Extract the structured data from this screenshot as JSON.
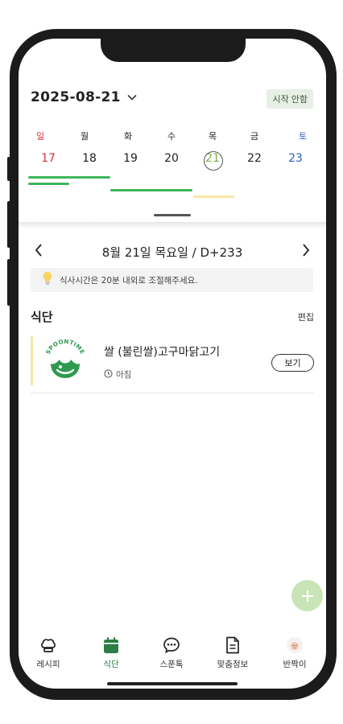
{
  "header": {
    "date": "2025-08-21",
    "guide_button": "시작 안함"
  },
  "week": {
    "days": [
      {
        "weekday": "일",
        "date": "17",
        "kind": "sun"
      },
      {
        "weekday": "월",
        "date": "18",
        "kind": "normal"
      },
      {
        "weekday": "화",
        "date": "19",
        "kind": "normal"
      },
      {
        "weekday": "수",
        "date": "20",
        "kind": "normal"
      },
      {
        "weekday": "목",
        "date": "21",
        "kind": "today"
      },
      {
        "weekday": "금",
        "date": "22",
        "kind": "normal"
      },
      {
        "weekday": "토",
        "date": "23",
        "kind": "sat"
      }
    ]
  },
  "day_nav": {
    "title": "8월 21일 목요일 / D+233"
  },
  "tip": {
    "text": "식사시간은 20분 내외로 조절해주세요."
  },
  "meals": {
    "section_title": "식단",
    "edit_label": "편집",
    "items": [
      {
        "name": "쌀 (불린쌀)고구마닭고기",
        "time": "아침",
        "view_label": "보기",
        "logo_text": "SPOONTIME"
      }
    ]
  },
  "colors": {
    "accent_green": "#2d7d46",
    "bar_green": "#3eb55b",
    "bar_yellow": "#f6e7a3",
    "sunday_red": "#d9343a",
    "saturday_blue": "#2a63c9"
  },
  "bottom_nav": {
    "tabs": [
      {
        "label": "레시피",
        "icon": "chef-hat-icon"
      },
      {
        "label": "식단",
        "icon": "calendar-icon",
        "active": true
      },
      {
        "label": "스푼톡",
        "icon": "chat-bubble-icon"
      },
      {
        "label": "맞춤정보",
        "icon": "document-icon"
      },
      {
        "label": "반짝이",
        "icon": "baby-avatar-icon"
      }
    ]
  }
}
